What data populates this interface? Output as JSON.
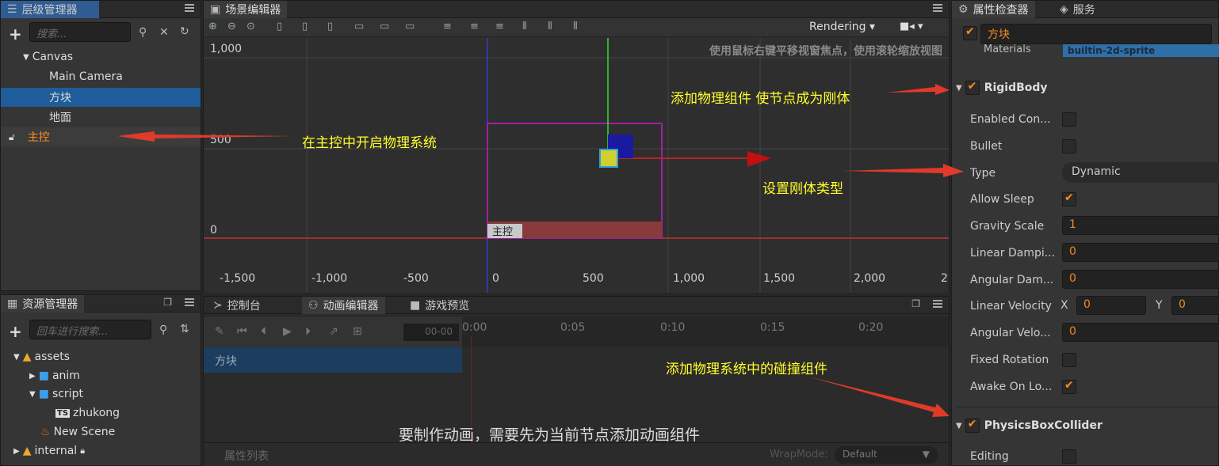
{
  "hierarchy": {
    "title": "层级管理器",
    "search_placeholder": "搜索...",
    "items": [
      {
        "label": "Canvas"
      },
      {
        "label": "Main Camera"
      },
      {
        "label": "方块"
      },
      {
        "label": "地面"
      },
      {
        "label": "主控"
      }
    ]
  },
  "scene": {
    "title": "场景编辑器",
    "rendering_label": "Rendering",
    "hint": "使用鼠标右键平移视窗焦点，使用滚轮缩放视图",
    "y_ticks": [
      "1,000",
      "500",
      "0"
    ],
    "x_ticks": [
      "-1,500",
      "-1,000",
      "-500",
      "0",
      "500",
      "1,000",
      "1,500",
      "2,000",
      "2"
    ],
    "node_label": "主控"
  },
  "assets": {
    "title": "资源管理器",
    "search_placeholder": "回车进行搜索...",
    "items": [
      {
        "label": "assets"
      },
      {
        "label": "anim"
      },
      {
        "label": "script"
      },
      {
        "label": "zhukong",
        "badge": "TS"
      },
      {
        "label": "New Scene"
      },
      {
        "label": "internal"
      }
    ]
  },
  "bottom": {
    "tabs": [
      "控制台",
      "动画编辑器",
      "游戏预览"
    ],
    "time_value": "00-00",
    "timeline_marks": [
      "0:00",
      "0:05",
      "0:10",
      "0:15",
      "0:20"
    ],
    "node": "方块",
    "message": "要制作动画，需要先为当前节点添加动画组件",
    "prop_list": "属性列表",
    "wrap_label": "WrapMode:",
    "wrap_value": "Default"
  },
  "inspector": {
    "tabs": [
      "属性检查器",
      "服务"
    ],
    "node_name": "方块",
    "materials_label": "Materials",
    "materials_value": "builtin-2d-sprite",
    "rigidbody_title": "RigidBody",
    "rows": {
      "enabled_contact": "Enabled Con...",
      "bullet": "Bullet",
      "type": "Type",
      "type_value": "Dynamic",
      "allow_sleep": "Allow Sleep",
      "gravity_scale": "Gravity Scale",
      "gravity_value": "1",
      "linear_damping": "Linear Dampi...",
      "linear_damping_value": "0",
      "angular_damping": "Angular Dam...",
      "angular_damping_value": "0",
      "linear_velocity": "Linear Velocity",
      "x_label": "X",
      "x_value": "0",
      "y_label": "Y",
      "y_value": "0",
      "angular_velocity": "Angular Velo...",
      "angular_velocity_value": "0",
      "fixed_rotation": "Fixed Rotation",
      "awake_on_load": "Awake On Lo..."
    },
    "collider_title": "PhysicsBoxCollider",
    "editing_label": "Editing"
  },
  "annotations": {
    "physics_system": "在主控中开启物理系统",
    "add_physics": "添加物理组件 使节点成为刚体",
    "set_type": "设置刚体类型",
    "add_collider": "添加物理系统中的碰撞组件"
  },
  "colors": {
    "accent": "#ff8c1a",
    "annotation": "#ffff2b",
    "arrow": "#e03a2a",
    "selection": "#1f5d9a"
  }
}
